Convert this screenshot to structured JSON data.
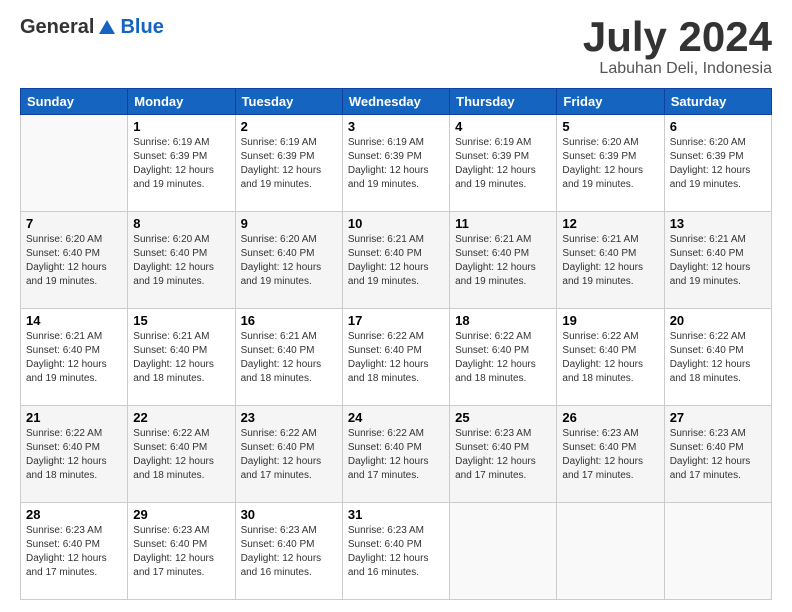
{
  "header": {
    "logo": {
      "general": "General",
      "blue": "Blue"
    },
    "title": "July 2024",
    "location": "Labuhan Deli, Indonesia"
  },
  "calendar": {
    "days_of_week": [
      "Sunday",
      "Monday",
      "Tuesday",
      "Wednesday",
      "Thursday",
      "Friday",
      "Saturday"
    ],
    "weeks": [
      [
        {
          "day": "",
          "info": ""
        },
        {
          "day": "1",
          "info": "Sunrise: 6:19 AM\nSunset: 6:39 PM\nDaylight: 12 hours\nand 19 minutes."
        },
        {
          "day": "2",
          "info": "Sunrise: 6:19 AM\nSunset: 6:39 PM\nDaylight: 12 hours\nand 19 minutes."
        },
        {
          "day": "3",
          "info": "Sunrise: 6:19 AM\nSunset: 6:39 PM\nDaylight: 12 hours\nand 19 minutes."
        },
        {
          "day": "4",
          "info": "Sunrise: 6:19 AM\nSunset: 6:39 PM\nDaylight: 12 hours\nand 19 minutes."
        },
        {
          "day": "5",
          "info": "Sunrise: 6:20 AM\nSunset: 6:39 PM\nDaylight: 12 hours\nand 19 minutes."
        },
        {
          "day": "6",
          "info": "Sunrise: 6:20 AM\nSunset: 6:39 PM\nDaylight: 12 hours\nand 19 minutes."
        }
      ],
      [
        {
          "day": "7",
          "info": "Sunrise: 6:20 AM\nSunset: 6:40 PM\nDaylight: 12 hours\nand 19 minutes."
        },
        {
          "day": "8",
          "info": "Sunrise: 6:20 AM\nSunset: 6:40 PM\nDaylight: 12 hours\nand 19 minutes."
        },
        {
          "day": "9",
          "info": "Sunrise: 6:20 AM\nSunset: 6:40 PM\nDaylight: 12 hours\nand 19 minutes."
        },
        {
          "day": "10",
          "info": "Sunrise: 6:21 AM\nSunset: 6:40 PM\nDaylight: 12 hours\nand 19 minutes."
        },
        {
          "day": "11",
          "info": "Sunrise: 6:21 AM\nSunset: 6:40 PM\nDaylight: 12 hours\nand 19 minutes."
        },
        {
          "day": "12",
          "info": "Sunrise: 6:21 AM\nSunset: 6:40 PM\nDaylight: 12 hours\nand 19 minutes."
        },
        {
          "day": "13",
          "info": "Sunrise: 6:21 AM\nSunset: 6:40 PM\nDaylight: 12 hours\nand 19 minutes."
        }
      ],
      [
        {
          "day": "14",
          "info": "Sunrise: 6:21 AM\nSunset: 6:40 PM\nDaylight: 12 hours\nand 19 minutes."
        },
        {
          "day": "15",
          "info": "Sunrise: 6:21 AM\nSunset: 6:40 PM\nDaylight: 12 hours\nand 18 minutes."
        },
        {
          "day": "16",
          "info": "Sunrise: 6:21 AM\nSunset: 6:40 PM\nDaylight: 12 hours\nand 18 minutes."
        },
        {
          "day": "17",
          "info": "Sunrise: 6:22 AM\nSunset: 6:40 PM\nDaylight: 12 hours\nand 18 minutes."
        },
        {
          "day": "18",
          "info": "Sunrise: 6:22 AM\nSunset: 6:40 PM\nDaylight: 12 hours\nand 18 minutes."
        },
        {
          "day": "19",
          "info": "Sunrise: 6:22 AM\nSunset: 6:40 PM\nDaylight: 12 hours\nand 18 minutes."
        },
        {
          "day": "20",
          "info": "Sunrise: 6:22 AM\nSunset: 6:40 PM\nDaylight: 12 hours\nand 18 minutes."
        }
      ],
      [
        {
          "day": "21",
          "info": "Sunrise: 6:22 AM\nSunset: 6:40 PM\nDaylight: 12 hours\nand 18 minutes."
        },
        {
          "day": "22",
          "info": "Sunrise: 6:22 AM\nSunset: 6:40 PM\nDaylight: 12 hours\nand 18 minutes."
        },
        {
          "day": "23",
          "info": "Sunrise: 6:22 AM\nSunset: 6:40 PM\nDaylight: 12 hours\nand 17 minutes."
        },
        {
          "day": "24",
          "info": "Sunrise: 6:22 AM\nSunset: 6:40 PM\nDaylight: 12 hours\nand 17 minutes."
        },
        {
          "day": "25",
          "info": "Sunrise: 6:23 AM\nSunset: 6:40 PM\nDaylight: 12 hours\nand 17 minutes."
        },
        {
          "day": "26",
          "info": "Sunrise: 6:23 AM\nSunset: 6:40 PM\nDaylight: 12 hours\nand 17 minutes."
        },
        {
          "day": "27",
          "info": "Sunrise: 6:23 AM\nSunset: 6:40 PM\nDaylight: 12 hours\nand 17 minutes."
        }
      ],
      [
        {
          "day": "28",
          "info": "Sunrise: 6:23 AM\nSunset: 6:40 PM\nDaylight: 12 hours\nand 17 minutes."
        },
        {
          "day": "29",
          "info": "Sunrise: 6:23 AM\nSunset: 6:40 PM\nDaylight: 12 hours\nand 17 minutes."
        },
        {
          "day": "30",
          "info": "Sunrise: 6:23 AM\nSunset: 6:40 PM\nDaylight: 12 hours\nand 16 minutes."
        },
        {
          "day": "31",
          "info": "Sunrise: 6:23 AM\nSunset: 6:40 PM\nDaylight: 12 hours\nand 16 minutes."
        },
        {
          "day": "",
          "info": ""
        },
        {
          "day": "",
          "info": ""
        },
        {
          "day": "",
          "info": ""
        }
      ]
    ]
  }
}
